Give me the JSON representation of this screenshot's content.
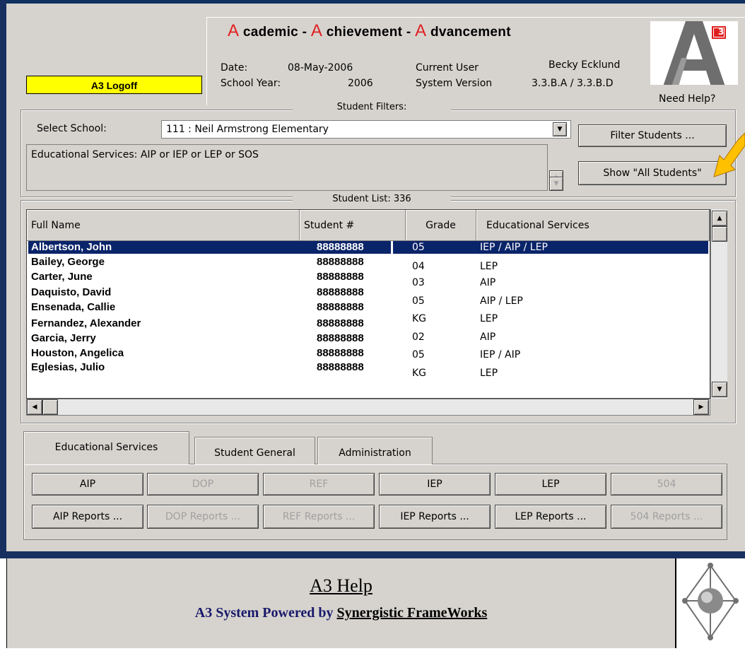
{
  "header": {
    "title_parts": [
      {
        "letter": "A",
        "rest": " cademic - "
      },
      {
        "letter": "A",
        "rest": " chievement - "
      },
      {
        "letter": "A",
        "rest": " dvancement"
      }
    ],
    "date_label": "Date:",
    "date_value": "08-May-2006",
    "school_year_label": "School Year:",
    "school_year_value": "2006",
    "current_user_label": "Current User",
    "current_user_value": "Becky Ecklund",
    "system_version_label": "System Version",
    "system_version_value": "3.3.B.A / 3.3.B.D",
    "need_help": "Need Help?",
    "logo_badge": "3",
    "logoff_label": "A3 Logoff"
  },
  "filters": {
    "legend": "Student Filters:",
    "select_school_label": "Select School:",
    "selected_school": "111 : Neil Armstrong Elementary",
    "filter_text": "Educational Services: AIP or IEP or LEP or SOS",
    "filter_button": "Filter Students ...",
    "show_all_button": "Show \"All Students\""
  },
  "student_list": {
    "legend": "Student List: 336",
    "columns": [
      "Full Name",
      "Student #",
      "Grade",
      "Educational Services"
    ],
    "rows": [
      {
        "name": "Albertson, John",
        "id": "88888888",
        "grade": "05",
        "services": "IEP / AIP / LEP",
        "selected": true
      },
      {
        "name": "Bailey, George",
        "id": "88888888",
        "grade": "04",
        "services": "LEP"
      },
      {
        "name": "Carter, June",
        "id": "88888888",
        "grade": "03",
        "services": "AIP"
      },
      {
        "name": "Daquisto, David",
        "id": "88888888",
        "grade": "05",
        "services": "AIP / LEP"
      },
      {
        "name": "Ensenada, Callie",
        "id": "88888888",
        "grade": "KG",
        "services": "LEP"
      },
      {
        "name": "Fernandez, Alexander",
        "id": "88888888",
        "grade": "02",
        "services": "AIP"
      },
      {
        "name": "Garcia, Jerry",
        "id": "88888888",
        "grade": "05",
        "services": "IEP / AIP"
      },
      {
        "name": "Houston, Angelica",
        "id": "88888888",
        "grade": "KG",
        "services": "LEP"
      },
      {
        "name": "Eglesias, Julio",
        "id": "88888888",
        "grade": "",
        "services": ""
      }
    ]
  },
  "tabs": [
    "Educational Services",
    "Student General",
    "Administration"
  ],
  "service_buttons": [
    {
      "label": "AIP",
      "enabled": true
    },
    {
      "label": "DOP",
      "enabled": false
    },
    {
      "label": "REF",
      "enabled": false
    },
    {
      "label": "IEP",
      "enabled": true
    },
    {
      "label": "LEP",
      "enabled": true
    },
    {
      "label": "504",
      "enabled": false
    }
  ],
  "report_buttons": [
    {
      "label": "AIP Reports ...",
      "enabled": true
    },
    {
      "label": "DOP Reports ...",
      "enabled": false
    },
    {
      "label": "REF Reports ...",
      "enabled": false
    },
    {
      "label": "IEP Reports ...",
      "enabled": true
    },
    {
      "label": "LEP Reports ...",
      "enabled": true
    },
    {
      "label": "504 Reports ...",
      "enabled": false
    }
  ],
  "help": {
    "title": "A3 Help",
    "subtitle_prefix": "A3 System Powered by ",
    "subtitle_link": "Synergistic FrameWorks"
  },
  "colors": {
    "accent_red": "#e02020",
    "logoff_yellow": "#ffff00",
    "selection_blue": "#0a246a",
    "pointer_arrow": "#ffc000"
  }
}
